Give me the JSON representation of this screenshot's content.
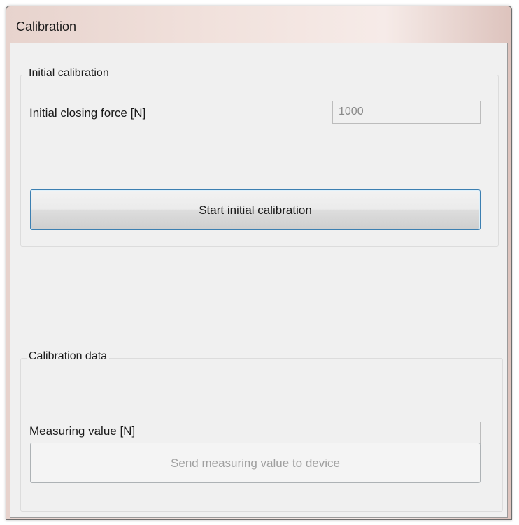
{
  "window": {
    "title": "Calibration"
  },
  "initial_calibration": {
    "group_title": "Initial calibration",
    "closing_force_label": "Initial closing force [N]",
    "closing_force_value": "1000",
    "start_button_label": "Start initial calibration"
  },
  "calibration_data": {
    "group_title": "Calibration data",
    "measuring_value_label": "Measuring value [N]",
    "measuring_value": "",
    "send_button_label": "Send measuring value to device"
  }
}
